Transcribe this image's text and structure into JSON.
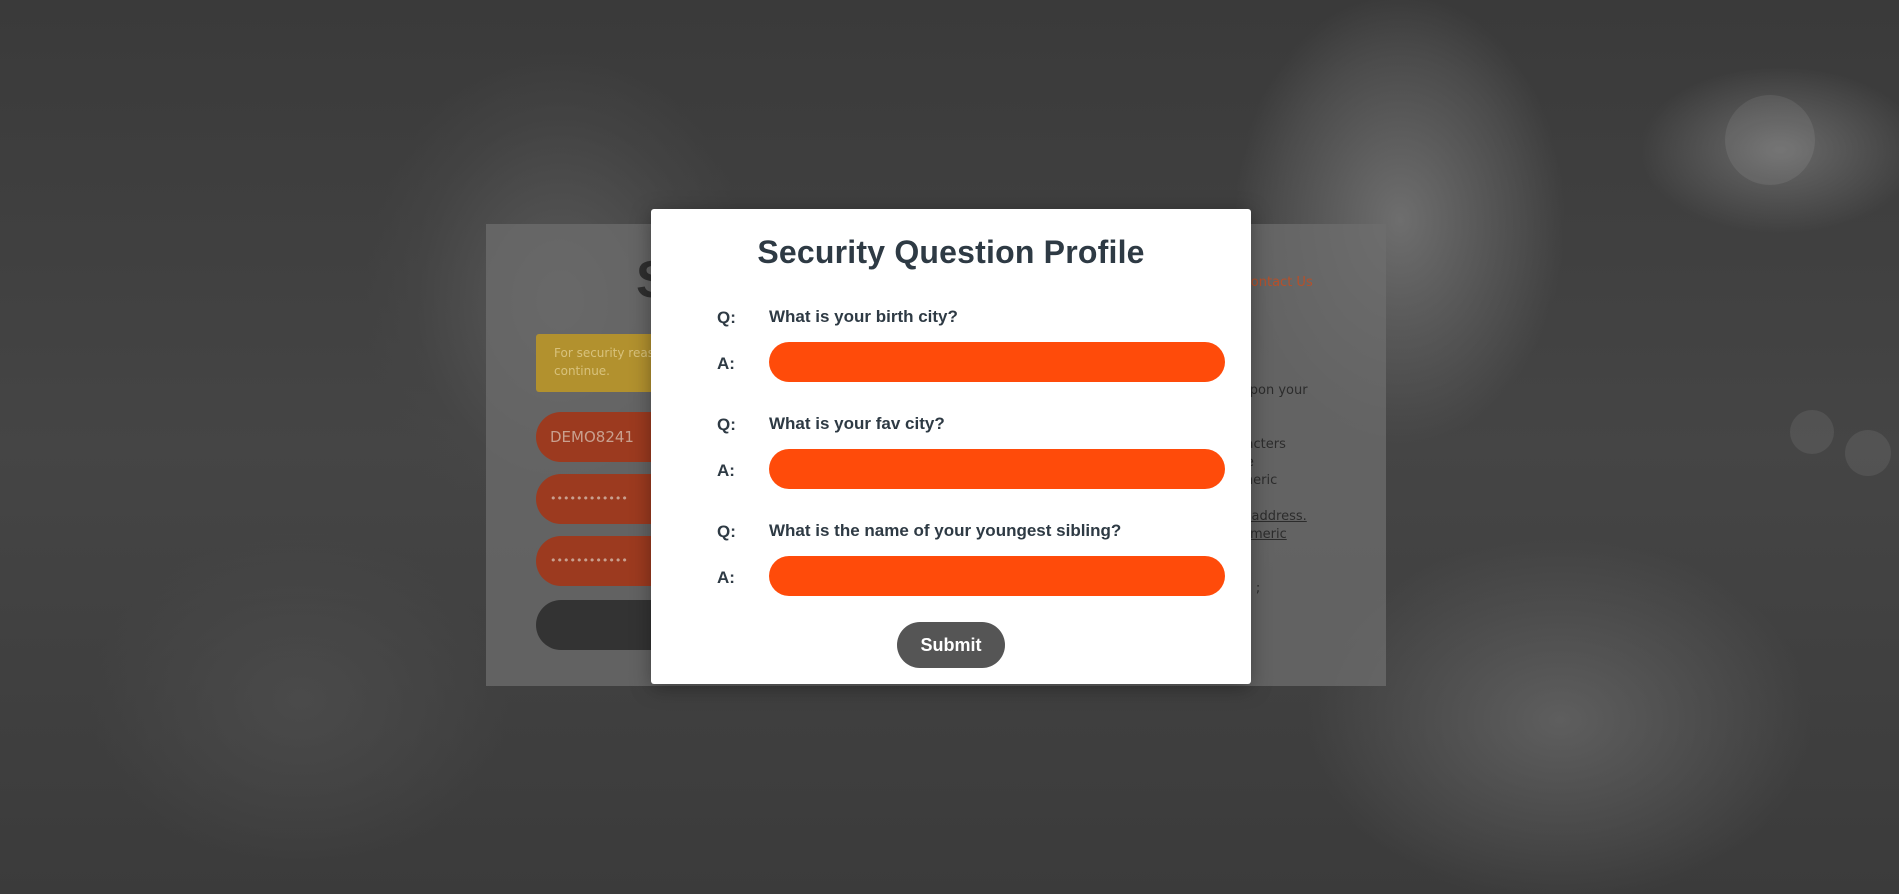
{
  "background_card": {
    "title_visible_fragment": "S",
    "notice_text": "For security rea… continue.",
    "notice_line1": "For security reas",
    "notice_line2": "continue.",
    "username_value": "DEMO8241",
    "password_mask": "••••••••••••",
    "confirm_password_mask": "••••••••••••",
    "right_panel": {
      "line1_prefix": "ur ",
      "contact_link": "Contact Us",
      "line2": "rd upon your",
      "line3": "haracters",
      "line4": "case",
      "line5": "numeric",
      "line6": "nail address.",
      "line7": "r numeric",
      "line8": "com ;",
      "line9": "l"
    }
  },
  "modal": {
    "title": "Security Question Profile",
    "q_label": "Q:",
    "a_label": "A:",
    "questions": [
      {
        "text": "What is your birth city?",
        "answer": ""
      },
      {
        "text": "What is your fav city?",
        "answer": ""
      },
      {
        "text": "What is the name of your youngest sibling?",
        "answer": ""
      }
    ],
    "submit_label": "Submit"
  },
  "colors": {
    "accent": "#ff4b0a",
    "title_text": "#2e3a44",
    "submit_bg": "#555555"
  }
}
